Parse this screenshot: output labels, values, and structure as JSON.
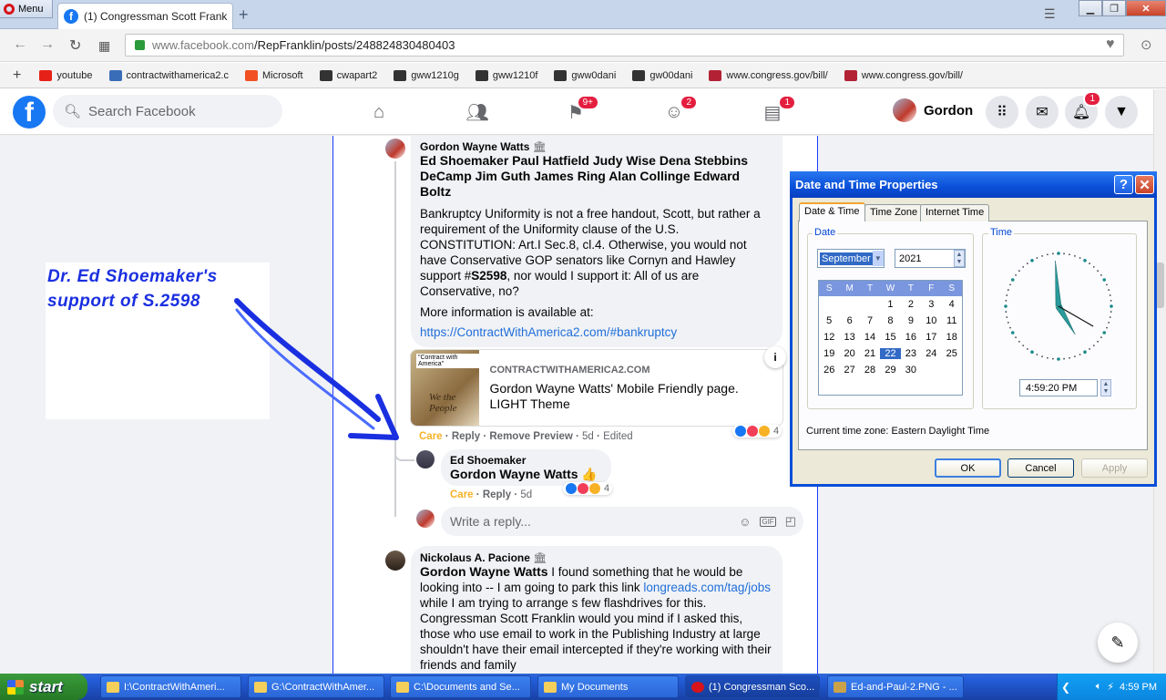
{
  "browser": {
    "menu_label": "Menu",
    "tab_title": "(1) Congressman Scott Frank",
    "url_prefix": "www.facebook.com",
    "url_path": "/RepFranklin/posts/248824830480403",
    "bookmarks": [
      {
        "label": "youtube",
        "color": "#e62117"
      },
      {
        "label": "contractwithamerica2.c",
        "color": "#3a6db8"
      },
      {
        "label": "Microsoft",
        "color": "#f25022"
      },
      {
        "label": "cwapart2",
        "color": "#333"
      },
      {
        "label": "gww1210g",
        "color": "#333"
      },
      {
        "label": "gww1210f",
        "color": "#333"
      },
      {
        "label": "gww0dani",
        "color": "#333"
      },
      {
        "label": "gw00dani",
        "color": "#333"
      },
      {
        "label": "www.congress.gov/bill/",
        "color": "#b22234"
      },
      {
        "label": "www.congress.gov/bill/",
        "color": "#b22234"
      }
    ]
  },
  "facebook": {
    "search_placeholder": "Search Facebook",
    "user_name": "Gordon",
    "badges": {
      "pages": "9+",
      "groups": "2",
      "gaming": "1",
      "notifications": "1"
    }
  },
  "comments": {
    "c1": {
      "author": "Gordon Wayne Watts",
      "tags": "Ed Shoemaker Paul Hatfield Judy Wise Dena Stebbins DeCamp Jim Guth James Ring Alan Collinge Edward Boltz",
      "p1a": "Bankruptcy Uniformity is not a free handout, Scott, but rather a requirement of the Uniformity clause of the U.S. CONSTITUTION: Art.I Sec.8, cl.4. Otherwise, you would not have Conservative GOP senators like Cornyn and Hawley support #",
      "p1b": "S2598",
      "p1c": ", nor would I support it: All of us are Conservative, no?",
      "p2": "More information is available at:",
      "link": "https://ContractWithAmerica2.com/#bankruptcy",
      "preview_domain": "CONTRACTWITHAMERICA2.COM",
      "preview_title": "Gordon Wayne Watts' Mobile Friendly page. LIGHT Theme",
      "preview_img_text": "\"Contract with America\"",
      "react_count": "4",
      "care": "Care",
      "reply": "Reply",
      "remove_preview": "Remove Preview",
      "time": "5d",
      "edited": "Edited"
    },
    "c2": {
      "author": "Ed Shoemaker",
      "text": "Gordon Wayne Watts",
      "emoji": "👍",
      "react_count": "4",
      "care": "Care",
      "reply": "Reply",
      "time": "5d"
    },
    "reply_placeholder": "Write a reply...",
    "c3": {
      "author": "Nickolaus A. Pacione",
      "tag": "Gordon Wayne Watts",
      "t1": " I found something that he would be looking into -- I am going to park this link ",
      "link": "longreads.com/tag/jobs",
      "t2": " while I am trying to arrange s few flashdrives for this. Congressman Scott Franklin would you mind if I asked this, those who use email to work in the Publishing Industry at large shouldn't have their email intercepted if they're working with their friends and family"
    }
  },
  "annotation": {
    "line1": "Dr. Ed  Shoemaker's",
    "line2": "support  of  S.2598"
  },
  "dialog": {
    "title": "Date and Time Properties",
    "tabs": [
      "Date & Time",
      "Time Zone",
      "Internet Time"
    ],
    "date_group": "Date",
    "time_group": "Time",
    "month": "September",
    "year": "2021",
    "weekdays": [
      "S",
      "M",
      "T",
      "W",
      "T",
      "F",
      "S"
    ],
    "weeks": [
      [
        "",
        "",
        "",
        "1",
        "2",
        "3",
        "4"
      ],
      [
        "5",
        "6",
        "7",
        "8",
        "9",
        "10",
        "11"
      ],
      [
        "12",
        "13",
        "14",
        "15",
        "16",
        "17",
        "18"
      ],
      [
        "19",
        "20",
        "21",
        "22",
        "23",
        "24",
        "25"
      ],
      [
        "26",
        "27",
        "28",
        "29",
        "30",
        "",
        ""
      ]
    ],
    "selected_day": "22",
    "time": "4:59:20 PM",
    "clock": {
      "hour": 4,
      "minute": 59,
      "second": 20
    },
    "timezone_label": "Current time zone:  Eastern Daylight Time",
    "ok": "OK",
    "cancel": "Cancel",
    "apply": "Apply"
  },
  "taskbar": {
    "start": "start",
    "tasks": [
      "I:\\ContractWithAmeri...",
      "G:\\ContractWithAmer...",
      "C:\\Documents and Se...",
      "My Documents",
      "(1) Congressman Sco...",
      "Ed-and-Paul-2.PNG - ..."
    ],
    "clock": "4:59 PM"
  }
}
